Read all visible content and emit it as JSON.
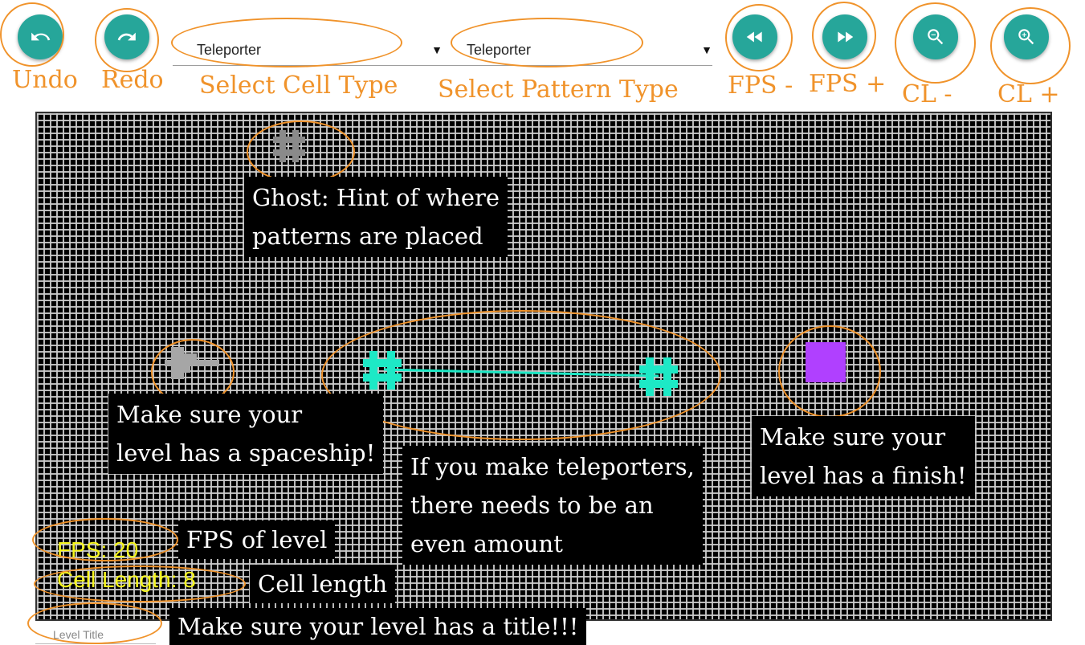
{
  "toolbar": {
    "undo_caption": "Undo",
    "redo_caption": "Redo",
    "fps_down_caption": "FPS -",
    "fps_up_caption": "FPS +",
    "cl_down_caption": "CL -",
    "cl_up_caption": "CL +",
    "cell_type": {
      "selected": "Teleporter",
      "caption": "Select Cell Type"
    },
    "pattern_type": {
      "selected": "Teleporter",
      "caption": "Select Pattern Type"
    }
  },
  "notes": {
    "ghost": [
      "Ghost: Hint of where",
      "patterns are placed"
    ],
    "spaceship": [
      "Make sure your",
      "level has a spaceship!"
    ],
    "teleporters": [
      "If you make teleporters,",
      "there needs to be an",
      "even amount"
    ],
    "finish": [
      "Make sure your",
      "level has a finish!"
    ],
    "fps": "FPS of level",
    "cell_length": "Cell length",
    "title": "Make sure your level has a title!!!"
  },
  "hud": {
    "fps": "FPS: 20",
    "cell_length": "Cell Length: 8"
  },
  "level_title": {
    "placeholder": "Level Title",
    "value": ""
  },
  "colors": {
    "button": "#26a69a",
    "annotation": "#f0932b",
    "teleporter": "#1de9c6",
    "finish": "#b040ff",
    "spaceship": "#9e9e9e",
    "hud": "#f5f51e"
  }
}
